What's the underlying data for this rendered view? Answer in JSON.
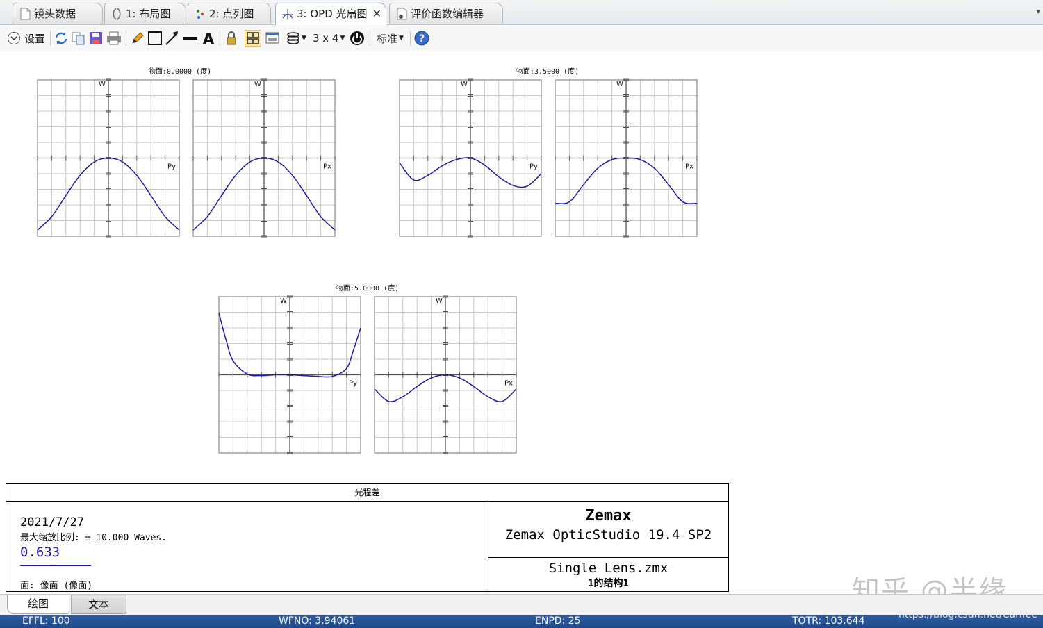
{
  "tabs": [
    {
      "label": "镜头数据",
      "icon": "document-icon"
    },
    {
      "label": "1: 布局图",
      "icon": "lens-layout-icon"
    },
    {
      "label": "2: 点列图",
      "icon": "spot-diagram-icon"
    },
    {
      "label": "3: OPD 光扇图",
      "icon": "opd-fan-icon",
      "active": true
    },
    {
      "label": "评价函数编辑器",
      "icon": "merit-function-icon"
    }
  ],
  "toolbar": {
    "settings_label": "设置",
    "grid_label": "3 x 4",
    "standard_label": "标准"
  },
  "chart_data": [
    {
      "type": "line",
      "title": "物面:0.0000 (度)",
      "panels": [
        {
          "xlabel": "Py",
          "ylabel": "W",
          "x": [
            -1,
            -0.8,
            -0.6,
            -0.4,
            -0.2,
            0,
            0.2,
            0.4,
            0.6,
            0.8,
            1
          ],
          "y": [
            -9.2,
            -7.5,
            -4.8,
            -2.2,
            -0.5,
            0,
            -0.5,
            -2.2,
            -4.8,
            -7.5,
            -9.2
          ]
        },
        {
          "xlabel": "Px",
          "ylabel": "W",
          "x": [
            -1,
            -0.8,
            -0.6,
            -0.4,
            -0.2,
            0,
            0.2,
            0.4,
            0.6,
            0.8,
            1
          ],
          "y": [
            -9.2,
            -7.5,
            -4.8,
            -2.2,
            -0.5,
            0,
            -0.5,
            -2.2,
            -4.8,
            -7.5,
            -9.2
          ]
        }
      ]
    },
    {
      "type": "line",
      "title": "物面:3.5000 (度)",
      "panels": [
        {
          "xlabel": "Py",
          "ylabel": "W",
          "x": [
            -1,
            -0.8,
            -0.6,
            -0.4,
            -0.2,
            0,
            0.2,
            0.4,
            0.6,
            0.8,
            1
          ],
          "y": [
            -0.6,
            -2.8,
            -2.2,
            -1.0,
            -0.2,
            0,
            -0.9,
            -2.4,
            -3.5,
            -3.6,
            -2.0
          ]
        },
        {
          "xlabel": "Px",
          "ylabel": "W",
          "x": [
            -1,
            -0.8,
            -0.6,
            -0.4,
            -0.2,
            0,
            0.2,
            0.4,
            0.6,
            0.8,
            1
          ],
          "y": [
            -5.8,
            -5.6,
            -3.4,
            -1.3,
            -0.2,
            0,
            -0.2,
            -1.3,
            -3.4,
            -5.6,
            -5.8
          ]
        }
      ]
    },
    {
      "type": "line",
      "title": "物面:5.0000 (度)",
      "panels": [
        {
          "xlabel": "Py",
          "ylabel": "W",
          "x": [
            -1,
            -0.9,
            -0.8,
            -0.6,
            -0.4,
            -0.2,
            0,
            0.2,
            0.4,
            0.6,
            0.8,
            0.9,
            1
          ],
          "y": [
            7.9,
            4.5,
            1.8,
            0.1,
            -0.1,
            0.0,
            0,
            -0.1,
            -0.2,
            -0.2,
            0.8,
            3.2,
            6.0
          ]
        },
        {
          "xlabel": "Px",
          "ylabel": "W",
          "x": [
            -1,
            -0.8,
            -0.6,
            -0.4,
            -0.2,
            0,
            0.2,
            0.4,
            0.6,
            0.8,
            1
          ],
          "y": [
            -1.8,
            -3.4,
            -2.8,
            -1.5,
            -0.4,
            0,
            -0.4,
            -1.5,
            -2.8,
            -3.4,
            -1.8
          ]
        }
      ]
    }
  ],
  "axis": {
    "ylim": [
      -10,
      10
    ],
    "xlim": [
      -1,
      1
    ],
    "line_color": "#1c1ca8"
  },
  "info": {
    "title": "光程差",
    "date": "2021/7/27",
    "scale": "最大缩放比例: ± 10.000 Waves.",
    "wavelength": "0.633",
    "surface": "面: 像面 (像面)",
    "brand": "Zemax",
    "product": "Zemax OpticStudio 19.4 SP2",
    "file": "Single Lens.zmx",
    "config": "1的结构1"
  },
  "bottom_tabs": {
    "plot": "绘图",
    "text": "文本"
  },
  "status": {
    "effl": "EFFL: 100",
    "wfno": "WFNO: 3.94061",
    "enpd": "ENPD: 25",
    "totr": "TOTR: 103.644"
  },
  "watermark": {
    "text": "知乎 @半缘",
    "url": "https://blog.csdn.net/Carifee"
  }
}
